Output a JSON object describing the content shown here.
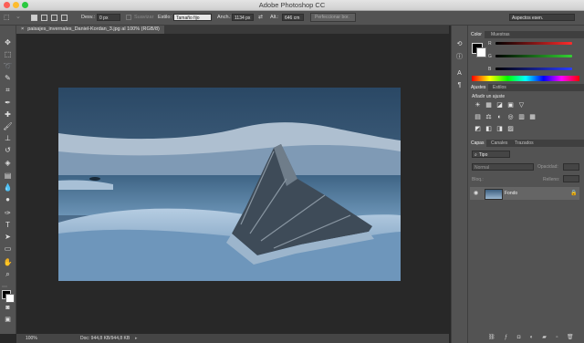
{
  "window": {
    "title": "Adobe Photoshop CC"
  },
  "options_bar": {
    "feather_label": "Desv.:",
    "feather_value": "0 px",
    "antialias_label": "Suavizar",
    "style_label": "Estilo:",
    "style_value": "Tamaño fijo",
    "width_label": "Anch.:",
    "width_value": "1134 px",
    "height_label": "Alt.:",
    "height_value": "646 cm",
    "refine_button": "Perfeccionar bor.",
    "workspace_value": "Aspectos esen."
  },
  "document": {
    "tab_title": "paisajes_invernales_Daniel-Kordan_3.jpg al 100% (RGB/8)",
    "close_icon": "×"
  },
  "status_bar": {
    "zoom": "100%",
    "doc_info": "Doc: 944,8 KB/944,8 KB"
  },
  "color_panel": {
    "tabs": [
      "Color",
      "Muestras"
    ],
    "channels": [
      "R",
      "G",
      "B"
    ],
    "colors": {
      "red": "#d83c3c",
      "green": "#3fb83f",
      "blue": "#3c4fd8"
    }
  },
  "adjustments_panel": {
    "tabs": [
      "Ajustes",
      "Estilos"
    ],
    "add_label": "Añadir un ajuste",
    "icons_row1": [
      "☀",
      "▦",
      "◪",
      "▣",
      "▽"
    ],
    "icons_row2": [
      "▤",
      "⚖",
      "◐",
      "◎",
      "▥",
      "▦"
    ],
    "icons_row3": [
      "◩",
      "◧",
      "◨",
      "▨"
    ]
  },
  "layers_panel": {
    "tabs": [
      "Capas",
      "Canales",
      "Trazados"
    ],
    "filter_label": "Tipo",
    "blend_mode": "Normal",
    "opacity_label": "Opacidad:",
    "lock_label": "Bloq.:",
    "fill_label": "Relleno:",
    "layers": [
      {
        "name": "Fondo",
        "visible": true,
        "locked": true
      }
    ]
  },
  "icons": {
    "toolbar": [
      "move-icon",
      "marquee-icon",
      "lasso-icon",
      "quick-select-icon",
      "crop-icon",
      "eyedropper-icon",
      "healing-brush-icon",
      "brush-icon",
      "clone-stamp-icon",
      "history-brush-icon",
      "eraser-icon",
      "gradient-icon",
      "blur-icon",
      "dodge-icon",
      "pen-icon",
      "type-icon",
      "path-select-icon",
      "rectangle-icon",
      "hand-icon",
      "zoom-icon"
    ]
  }
}
